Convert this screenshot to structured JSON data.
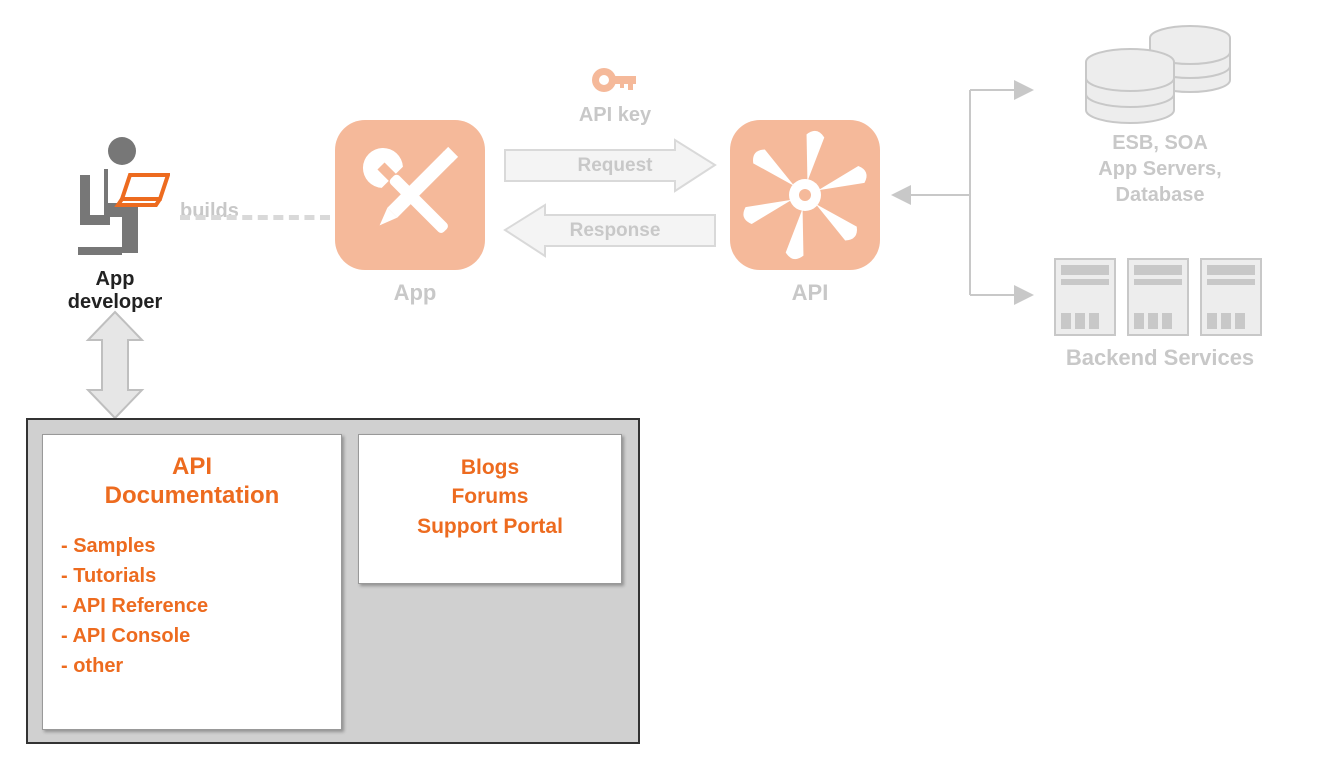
{
  "developer": {
    "label": "App developer"
  },
  "builds": {
    "label": "builds"
  },
  "app": {
    "label": "App"
  },
  "apikey": {
    "label": "API key"
  },
  "request": {
    "label": "Request"
  },
  "response": {
    "label": "Response"
  },
  "api": {
    "label": "API"
  },
  "backend": {
    "top": {
      "line1": "ESB, SOA",
      "line2": "App Servers,",
      "line3": "Database"
    },
    "services_label": "Backend Services"
  },
  "docs": {
    "left": {
      "title_line1": "API",
      "title_line2": "Documentation",
      "items": [
        "Samples",
        "Tutorials",
        "API Reference",
        "API Console",
        "other"
      ]
    },
    "right": {
      "line1": "Blogs",
      "line2": "Forums",
      "line3": "Support Portal"
    }
  }
}
